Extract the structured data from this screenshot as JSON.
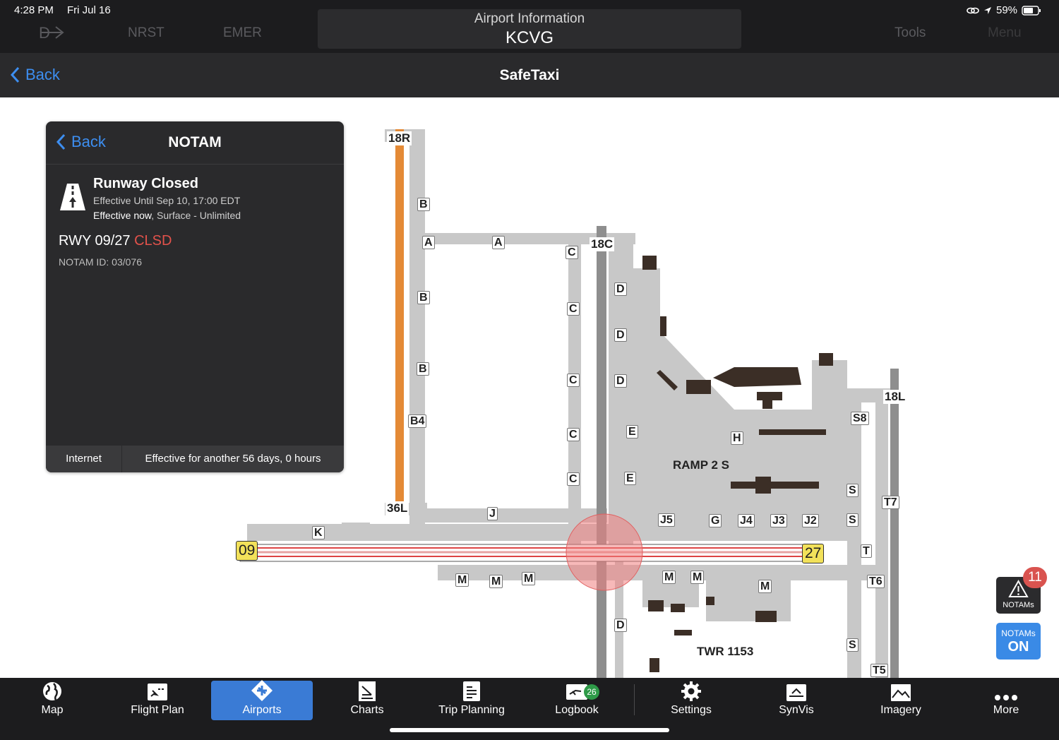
{
  "status_bar": {
    "time": "4:28 PM",
    "date": "Fri Jul 16",
    "battery": "59%"
  },
  "top_nav": {
    "items": [
      "NRST",
      "EMER"
    ],
    "title_small": "Airport Information",
    "title_large": "KCVG",
    "tools": "Tools",
    "menu": "Menu"
  },
  "sub_nav": {
    "back": "Back",
    "title": "SafeTaxi"
  },
  "notam_panel": {
    "back": "Back",
    "title": "NOTAM",
    "heading": "Runway Closed",
    "effective_until": "Effective Until Sep 10, 17:00 EDT",
    "effective_now": "Effective now",
    "effective_now_rest": ", Surface - Unlimited",
    "runway": "RWY 09/27",
    "runway_status": "CLSD",
    "notam_id": "NOTAM ID: 03/076",
    "source": "Internet",
    "duration": "Effective for another 56 days, 0 hours"
  },
  "map_labels": {
    "runway_ends": [
      "18R",
      "36L",
      "18C",
      "18L",
      "09",
      "27"
    ],
    "taxiways": [
      "A",
      "A",
      "B",
      "B",
      "B",
      "B4",
      "C",
      "C",
      "C",
      "C",
      "C",
      "D",
      "D",
      "D",
      "D",
      "E",
      "E",
      "H",
      "S8",
      "S",
      "S",
      "S",
      "T",
      "T7",
      "T6",
      "T5",
      "J",
      "J5",
      "G",
      "J4",
      "J3",
      "J2",
      "K",
      "M",
      "M",
      "M",
      "M",
      "M",
      "M"
    ],
    "ramp": "RAMP 2 S",
    "tower": "TWR 1153"
  },
  "right_buttons": {
    "notams_label": "NOTAMs",
    "notams_count": "11",
    "toggle_top": "NOTAMs",
    "toggle_state": "ON"
  },
  "tab_bar": {
    "items": [
      {
        "label": "Map",
        "icon": "globe-icon"
      },
      {
        "label": "Flight Plan",
        "icon": "flight-plan-icon"
      },
      {
        "label": "Airports",
        "icon": "airport-icon"
      },
      {
        "label": "Charts",
        "icon": "charts-icon"
      },
      {
        "label": "Trip Planning",
        "icon": "trip-planning-icon"
      },
      {
        "label": "Logbook",
        "icon": "logbook-icon",
        "badge": "26"
      },
      {
        "label": "Settings",
        "icon": "gear-icon"
      },
      {
        "label": "SynVis",
        "icon": "synvis-icon"
      },
      {
        "label": "Imagery",
        "icon": "imagery-icon"
      },
      {
        "label": "More",
        "icon": "more-icon"
      }
    ],
    "active": "Airports"
  },
  "colors": {
    "accent": "#3a7bd5",
    "closed": "#e2524b",
    "runway_closed_fill": "#f0a0a0",
    "taxiway": "#c8c8c8",
    "runway": "#8e8e8e",
    "buildings": "#3b2e26",
    "highlight_runway": "#e48a36"
  }
}
